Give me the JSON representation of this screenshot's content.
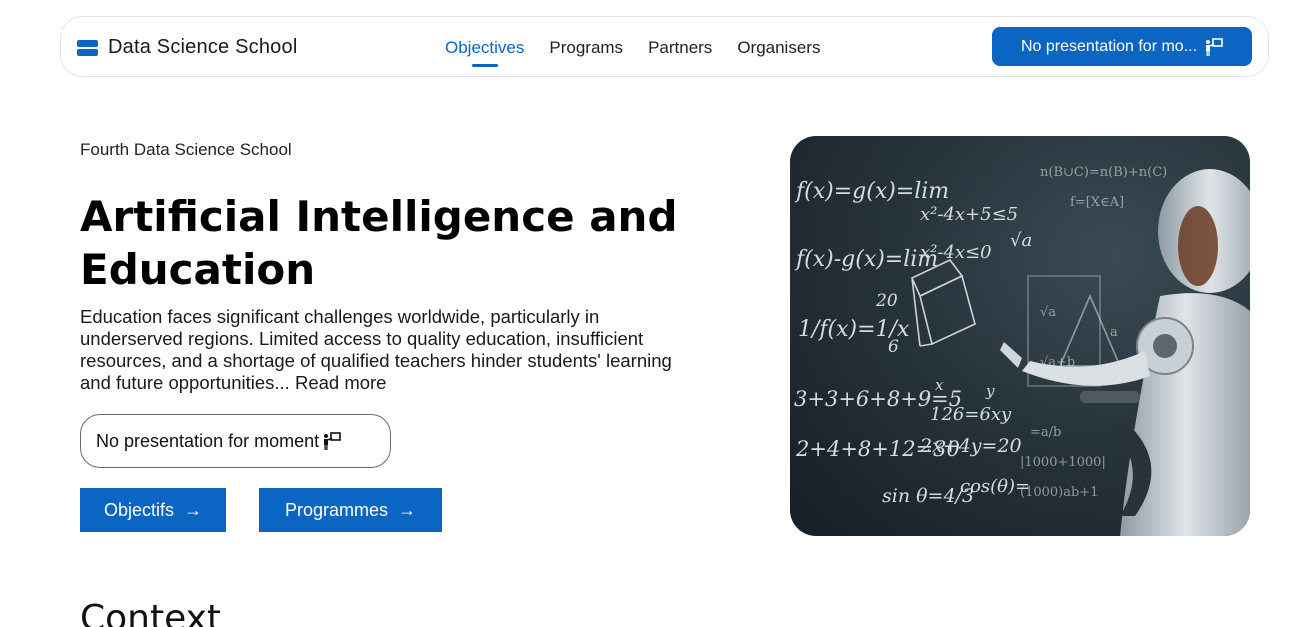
{
  "brand": {
    "name": "Data Science School",
    "icon": "server-icon",
    "accent": "#0a66c2"
  },
  "nav": {
    "links": [
      {
        "label": "Objectives",
        "active": true
      },
      {
        "label": "Programs",
        "active": false
      },
      {
        "label": "Partners",
        "active": false
      },
      {
        "label": "Organisers",
        "active": false
      }
    ],
    "cta_label": "No presentation for mo...",
    "cta_icon": "presenter-icon"
  },
  "hero": {
    "kicker": "Fourth Data Science School",
    "title_line1": "Artificial Intelligence and",
    "title_line2": "Education",
    "description": "Education faces significant challenges worldwide, particularly in underserved regions. Limited access to quality education, insufficient resources, and a shortage of qualified teachers hinder students' learning and future opportunities...",
    "read_more": "Read more",
    "presentation_button": "No presentation for moment",
    "buttons": {
      "objectifs": "Objectifs",
      "programmes": "Programmes"
    },
    "image": {
      "description_icon": "robot-chalkboard-image",
      "formulas": [
        "f(x)=g(x)=lim",
        "x²-4x+5≤5",
        "f(x)-g(x)=lim",
        "x²-4x≤0",
        "1/f(x)=1/x",
        "3+3+6+8+9=5",
        "2+4+8+12=30",
        "2x+4y=20",
        "126=6xy",
        "sin θ=4/3",
        "cos(θ)=",
        "20",
        "6",
        "√a",
        "x",
        "y"
      ]
    }
  },
  "context": {
    "title": "Context"
  }
}
